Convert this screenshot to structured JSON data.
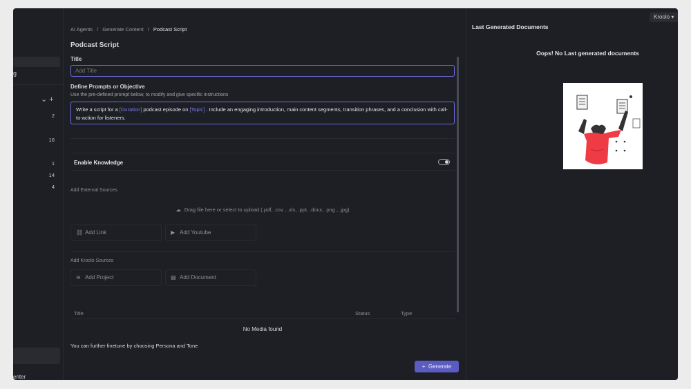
{
  "top_right": {
    "user_label": "Kroolo ▾"
  },
  "sidebar": {
    "partial_item": "g",
    "tools_icons": "⌄  +",
    "counts": [
      "2",
      "16",
      "1",
      "14",
      "4"
    ],
    "bottom_label": "enter"
  },
  "breadcrumb": [
    "AI Agents",
    "Generate Content",
    "Podcast Script"
  ],
  "page_title": "Podcast Script",
  "title_field": {
    "label": "Title",
    "value": "Add Title"
  },
  "prompt": {
    "label": "Define Prompts or Objective",
    "hint": "Use the pre-defined prompt below, to modify and give specific instructions",
    "text_1": "Write a script for a ",
    "tag_duration": "[Duration]",
    "text_2": " podcast episode on ",
    "tag_topic": "[Topic]",
    "text_3": " . Include an engaging introduction, main content segments, transition phrases, and a conclusion with call-to-action for listeners."
  },
  "knowledge": {
    "label": "Enable Knowledge",
    "enabled": false
  },
  "external_sources": {
    "label": "Add External Sources",
    "drop_text": "Drag file here or select to upload (.pdf, .csv , .xls, .ppt, .docx, .png , .jpg)",
    "add_link": "Add Link",
    "add_youtube": "Add Youtube"
  },
  "kroolo_sources": {
    "label": "Add Kroolo Sources",
    "add_project": "Add Project",
    "add_document": "Add Document"
  },
  "media_table": {
    "columns": [
      "Title",
      "Status",
      "Type"
    ],
    "empty_text": "No Media found"
  },
  "finetune_text": "You can further finetune by choosing Persona and Tone",
  "generate_button": "Generate",
  "right_panel": {
    "title": "Last Generated Documents",
    "empty_text": "Oops! No Last generated documents"
  },
  "colors": {
    "accent": "#6e6ee6",
    "button": "#5b5bc4",
    "background": "#1e1f24"
  }
}
